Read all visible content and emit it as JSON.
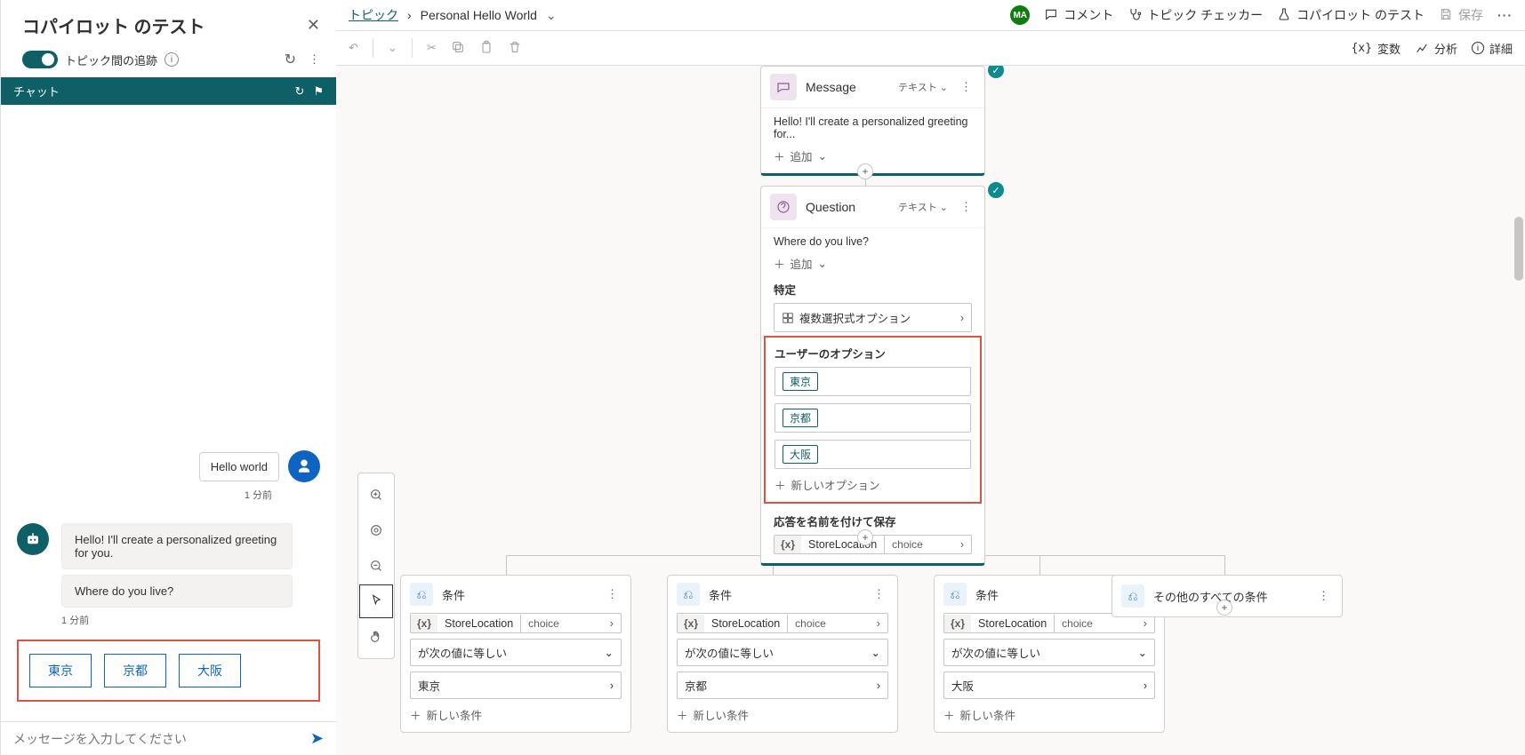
{
  "test_panel": {
    "title": "コパイロット のテスト",
    "toggle_label": "トピック間の追跡",
    "chat_tab_label": "チャット",
    "timestamp": "1 分前",
    "user_message": "Hello world",
    "bot_message_1": "Hello! I'll create a personalized greeting for you.",
    "bot_message_2": "Where do you live?",
    "options": [
      "東京",
      "京都",
      "大阪"
    ],
    "composer_placeholder": "メッセージを入力してください"
  },
  "breadcrumb": {
    "topics": "トピック",
    "current": "Personal Hello World"
  },
  "actions": {
    "ma_badge": "MA",
    "comments": "コメント",
    "topic_checker": "トピック チェッカー",
    "test_copilot": "コパイロット のテスト",
    "save": "保存",
    "variables": "変数",
    "analysis": "分析",
    "details": "詳細"
  },
  "nodes": {
    "message": {
      "title": "Message",
      "format_label": "テキスト",
      "body": "Hello! I'll create a personalized greeting for...",
      "add_label": "追加"
    },
    "question": {
      "title": "Question",
      "format_label": "テキスト",
      "body": "Where do you live?",
      "add_label": "追加",
      "identify_label": "特定",
      "identify_value": "複数選択式オプション",
      "user_options_label": "ユーザーのオプション",
      "options": [
        "東京",
        "京都",
        "大阪"
      ],
      "new_option": "新しいオプション",
      "save_var_label": "応答を名前を付けて保存",
      "var_name": "StoreLocation",
      "var_type": "choice"
    },
    "cond": {
      "title": "条件",
      "var_name": "StoreLocation",
      "var_type": "choice",
      "op": "が次の値に等しい",
      "values": [
        "東京",
        "京都",
        "大阪"
      ],
      "add_cond": "新しい条件"
    },
    "cond_other": {
      "title": "その他のすべての条件"
    }
  }
}
